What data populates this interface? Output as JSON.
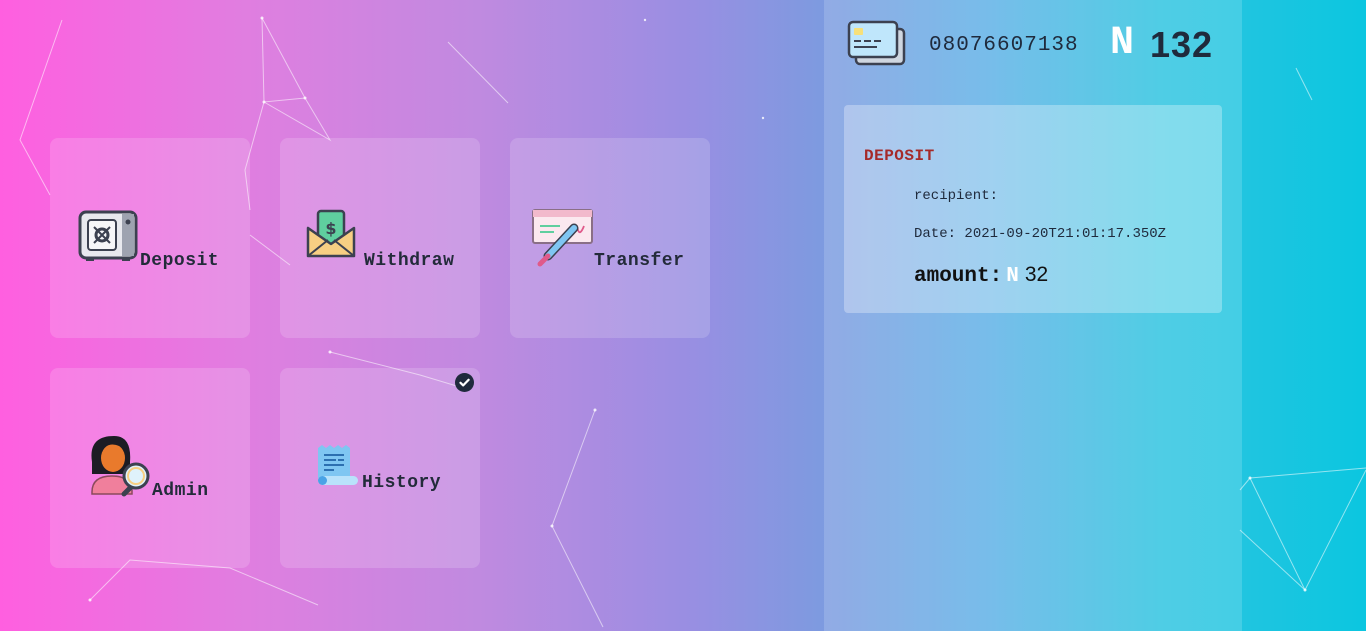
{
  "tiles": [
    {
      "label": "Deposit",
      "icon": "safe-icon"
    },
    {
      "label": "Withdraw",
      "icon": "cash-envelope-icon"
    },
    {
      "label": "Transfer",
      "icon": "cheque-pen-icon"
    },
    {
      "label": "Admin",
      "icon": "admin-search-icon"
    },
    {
      "label": "History",
      "icon": "receipt-scroll-icon",
      "selected": true
    }
  ],
  "account": {
    "icon": "id-card-icon",
    "number": "08076607138",
    "currency_symbol": "N",
    "balance": "132"
  },
  "transaction": {
    "type": "DEPOSIT",
    "recipient_label": "recipient:",
    "recipient_value": "",
    "date_label": "Date:",
    "date_value": "2021-09-20T21:01:17.350Z",
    "amount_label": "amount:",
    "amount_currency": "N",
    "amount_value": "32"
  },
  "colors": {
    "gradient_left": "#ff5fe0",
    "gradient_right": "#0bc6e0",
    "text_dark": "#1f2a3c",
    "transaction_type": "#a52a2a",
    "currency": "#ffffff"
  }
}
